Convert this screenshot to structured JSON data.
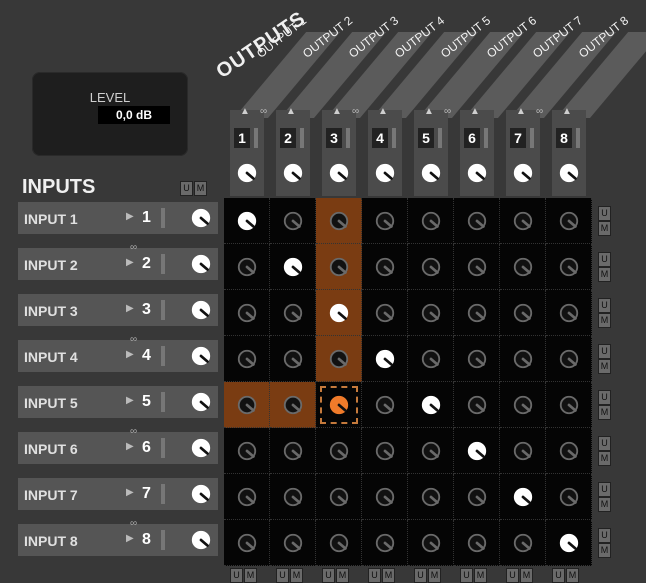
{
  "level": {
    "label": "LEVEL",
    "value": "0,0 dB"
  },
  "outputs": {
    "heading": "OUTPUTS",
    "items": [
      {
        "label": "OUTPUT 1",
        "num": "1"
      },
      {
        "label": "OUTPUT 2",
        "num": "2"
      },
      {
        "label": "OUTPUT 3",
        "num": "3"
      },
      {
        "label": "OUTPUT 4",
        "num": "4"
      },
      {
        "label": "OUTPUT 5",
        "num": "5"
      },
      {
        "label": "OUTPUT 6",
        "num": "6"
      },
      {
        "label": "OUTPUT 7",
        "num": "7"
      },
      {
        "label": "OUTPUT 8",
        "num": "8"
      }
    ]
  },
  "inputs": {
    "heading": "INPUTS",
    "u": "U",
    "m": "M",
    "items": [
      {
        "label": "INPUT 1",
        "num": "1"
      },
      {
        "label": "INPUT 2",
        "num": "2"
      },
      {
        "label": "INPUT 3",
        "num": "3"
      },
      {
        "label": "INPUT 4",
        "num": "4"
      },
      {
        "label": "INPUT 5",
        "num": "5"
      },
      {
        "label": "INPUT 6",
        "num": "6"
      },
      {
        "label": "INPUT 7",
        "num": "7"
      },
      {
        "label": "INPUT 8",
        "num": "8"
      }
    ]
  },
  "matrix": {
    "diagonal_on": true,
    "selected": {
      "row": 5,
      "col": 3
    },
    "highlight_color": "#7a3c12",
    "active_color": "#f07b2a"
  }
}
